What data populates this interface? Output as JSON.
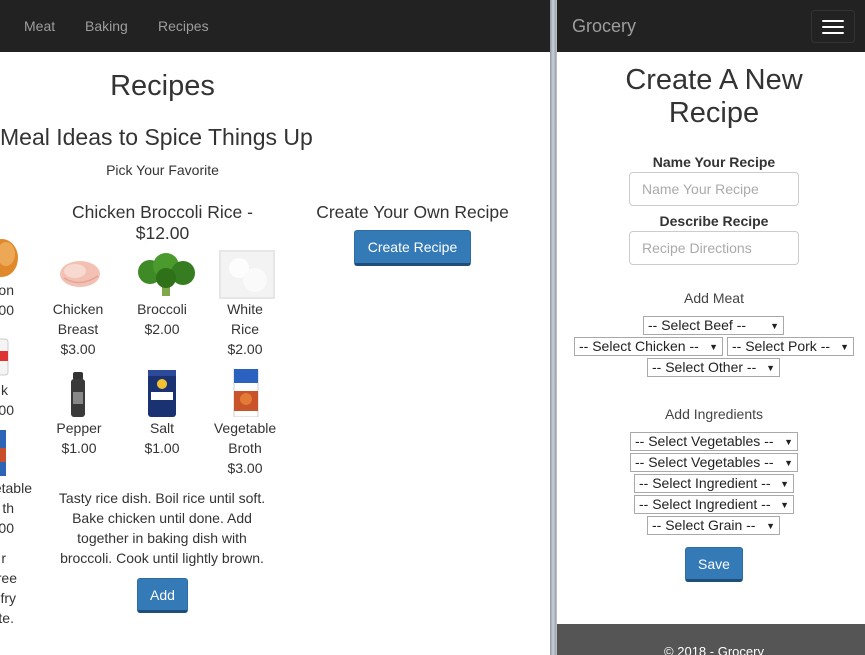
{
  "nav": {
    "items": [
      "Meat",
      "Baking",
      "Recipes"
    ]
  },
  "page": {
    "title": "Recipes",
    "subtitle": "Meal Ideas to Spice Things Up",
    "tagline": "Pick Your Favorite"
  },
  "partial_column": {
    "lines": [
      "on",
      "00",
      "k",
      "00",
      "etable",
      "th",
      "00",
      "r",
      "ree",
      "fry",
      "te."
    ]
  },
  "recipe": {
    "title_line1": "Chicken Broccoli Rice -",
    "title_line2": "$12.00",
    "ingredients": [
      {
        "name_line1": "Chicken",
        "name_line2": "Breast",
        "price": "$3.00",
        "icon": "chicken-breast-image"
      },
      {
        "name_line1": "Broccoli",
        "name_line2": "",
        "price": "$2.00",
        "icon": "broccoli-image"
      },
      {
        "name_line1": "White",
        "name_line2": "Rice",
        "price": "$2.00",
        "icon": "white-rice-image"
      },
      {
        "name_line1": "Pepper",
        "name_line2": "",
        "price": "$1.00",
        "icon": "pepper-grinder-image"
      },
      {
        "name_line1": "Salt",
        "name_line2": "",
        "price": "$1.00",
        "icon": "salt-container-image"
      },
      {
        "name_line1": "Vegetable",
        "name_line2": "Broth",
        "price": "$3.00",
        "icon": "vegetable-broth-image"
      }
    ],
    "description": [
      "Tasty rice dish. Boil rice until soft.",
      "Bake chicken until done. Add",
      "together in baking dish with",
      "broccoli. Cook until lightly brown."
    ],
    "add_label": "Add"
  },
  "create_own": {
    "title": "Create Your Own Recipe",
    "button_label": "Create Recipe"
  },
  "mobile": {
    "brand": "Grocery",
    "title_line1": "Create A New",
    "title_line2": "Recipe",
    "name_label": "Name Your Recipe",
    "name_placeholder": "Name Your Recipe",
    "describe_label": "Describe Recipe",
    "describe_placeholder": "Recipe Directions",
    "add_meat": "Add Meat",
    "meat_selects": [
      "-- Select Beef --",
      "-- Select Chicken --",
      "-- Select Pork --",
      "-- Select Other --"
    ],
    "add_ingredients": "Add Ingredients",
    "ingredient_selects": [
      "-- Select Vegetables --",
      "-- Select Vegetables --",
      "-- Select Ingredient --",
      "-- Select Ingredient --",
      "-- Select Grain --"
    ],
    "save_label": "Save",
    "footer": "© 2018 - Grocery"
  },
  "colors": {
    "navbar": "#222222",
    "primary": "#337ab7",
    "footer": "#555555"
  }
}
